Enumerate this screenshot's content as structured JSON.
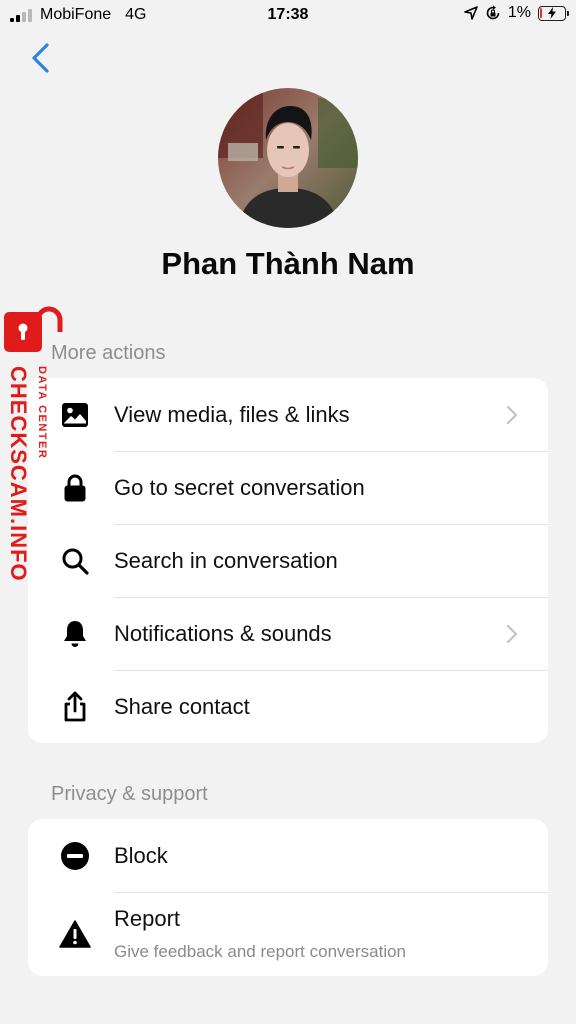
{
  "status_bar": {
    "carrier": "MobiFone",
    "network": "4G",
    "time": "17:38",
    "battery": "1%",
    "battery_color": "#e8312f"
  },
  "nav": {
    "back_icon": "chevron-left-icon",
    "accent_color": "#2f80e8"
  },
  "profile": {
    "name": "Phan Thành Nam"
  },
  "more_actions": {
    "header": "More actions",
    "items": [
      {
        "icon": "image-icon",
        "label": "View media, files & links",
        "has_chevron": true
      },
      {
        "icon": "lock-icon",
        "label": "Go to secret conversation",
        "has_chevron": false
      },
      {
        "icon": "search-icon",
        "label": "Search in conversation",
        "has_chevron": false
      },
      {
        "icon": "bell-icon",
        "label": "Notifications & sounds",
        "has_chevron": true
      },
      {
        "icon": "share-icon",
        "label": "Share contact",
        "has_chevron": false
      }
    ]
  },
  "privacy_support": {
    "header": "Privacy & support",
    "items": [
      {
        "icon": "block-icon",
        "label": "Block"
      },
      {
        "icon": "warning-icon",
        "label": "Report",
        "sublabel": "Give feedback and report conversation"
      }
    ]
  },
  "watermark": {
    "main": "CHECKSCAM.INFO",
    "sub": "DATA CENTER",
    "color": "#e01b1b"
  }
}
